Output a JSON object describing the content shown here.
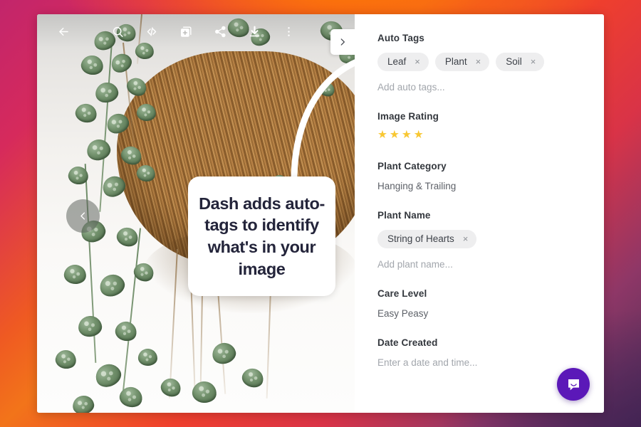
{
  "window": {
    "viewer": {
      "toolbar": [
        {
          "name": "back-icon",
          "label": "Back"
        },
        {
          "name": "search-icon",
          "label": "Search"
        },
        {
          "name": "embed-code-icon",
          "label": "Embed code"
        },
        {
          "name": "add-to-collection-icon",
          "label": "Add to collection"
        },
        {
          "name": "share-icon",
          "label": "Share"
        },
        {
          "name": "download-icon",
          "label": "Download"
        },
        {
          "name": "more-options-icon",
          "label": "More options"
        }
      ],
      "prev_label": "Previous image",
      "next_label": "Next image"
    },
    "callout": {
      "text": "Dash adds auto-tags to identify what's in your image"
    },
    "panel": {
      "auto_tags": {
        "label": "Auto Tags",
        "chips": [
          "Leaf",
          "Plant",
          "Soil"
        ],
        "remove_glyph": "×",
        "placeholder": "Add auto tags..."
      },
      "image_rating": {
        "label": "Image Rating",
        "stars_filled": 4,
        "stars_total": 4,
        "star_glyph": "★",
        "star_color": "#f8c732"
      },
      "plant_category": {
        "label": "Plant Category",
        "value": "Hanging & Trailing"
      },
      "plant_name": {
        "label": "Plant Name",
        "chips": [
          "String of Hearts"
        ],
        "remove_glyph": "×",
        "placeholder": "Add plant name..."
      },
      "care_level": {
        "label": "Care Level",
        "value": "Easy Peasy"
      },
      "date_created": {
        "label": "Date Created",
        "placeholder": "Enter a date and time..."
      }
    },
    "intercom": {
      "label": "Open chat",
      "color": "#5b18b8"
    }
  }
}
